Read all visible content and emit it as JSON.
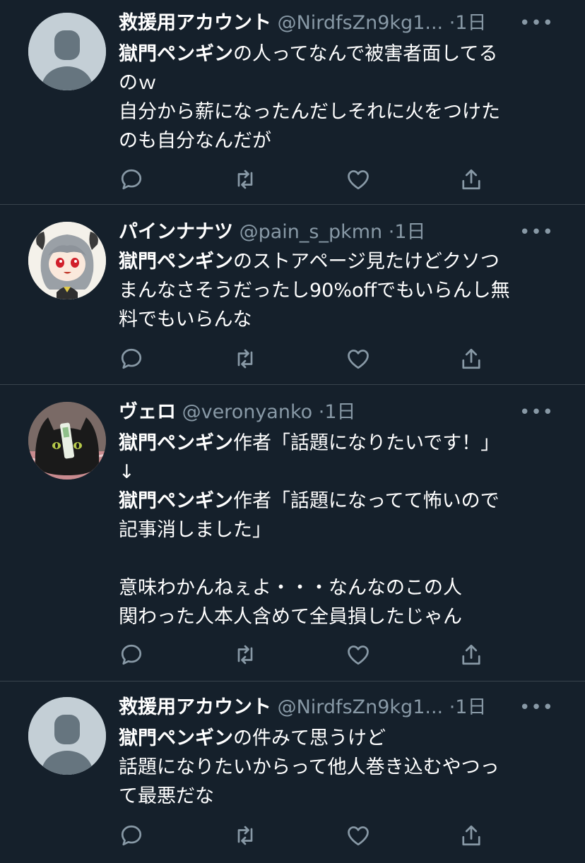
{
  "tweets": [
    {
      "name": "救援用アカウント",
      "handle": "@NirdfsZn9kg1...",
      "time": "·1日",
      "avatar": "default-avatar",
      "lines": [
        {
          "bold": "獄門ペンギン",
          "text": "の人ってなんで被害者面してる"
        },
        {
          "bold": "",
          "text": "のｗ"
        },
        {
          "bold": "",
          "text": "自分から薪になったんだしそれに火をつけた"
        },
        {
          "bold": "",
          "text": "のも自分なんだが"
        }
      ]
    },
    {
      "name": "パインナナツ",
      "handle": "@pain_s_pkmn",
      "time": "·1日",
      "avatar": "anime-character-avatar",
      "lines": [
        {
          "bold": "獄門ペンギン",
          "text": "のストアページ見たけどクソつ"
        },
        {
          "bold": "",
          "text": "まんなさそうだったし90%offでもいらんし無"
        },
        {
          "bold": "",
          "text": "料でもいらんな"
        }
      ]
    },
    {
      "name": "ヴェロ",
      "handle": "@veronyanko",
      "time": "·1日",
      "avatar": "black-cat-avatar",
      "lines": [
        {
          "bold": "獄門ペンギン",
          "text": "作者「話題になりたいです！」"
        },
        {
          "bold": "",
          "text": "↓"
        },
        {
          "bold": "獄門ペンギン",
          "text": "作者「話題になってて怖いので"
        },
        {
          "bold": "",
          "text": "記事消しました」"
        },
        {
          "bold": "",
          "text": ""
        },
        {
          "bold": "",
          "text": "意味わかんねぇよ・・・なんなのこの人"
        },
        {
          "bold": "",
          "text": "関わった人本人含めて全員損したじゃん"
        }
      ]
    },
    {
      "name": "救援用アカウント",
      "handle": "@NirdfsZn9kg1...",
      "time": "·1日",
      "avatar": "default-avatar",
      "lines": [
        {
          "bold": "獄門ペンギン",
          "text": "の件みて思うけど"
        },
        {
          "bold": "",
          "text": "話題になりたいからって他人巻き込むやつっ"
        },
        {
          "bold": "",
          "text": "て最悪だな"
        }
      ]
    }
  ],
  "more_label": "•••",
  "icons": [
    "reply-icon",
    "retweet-icon",
    "like-icon",
    "share-icon"
  ],
  "colors": {
    "background": "#15202b",
    "text": "#ffffff",
    "secondary": "#8899a6",
    "divider": "#38444d"
  }
}
